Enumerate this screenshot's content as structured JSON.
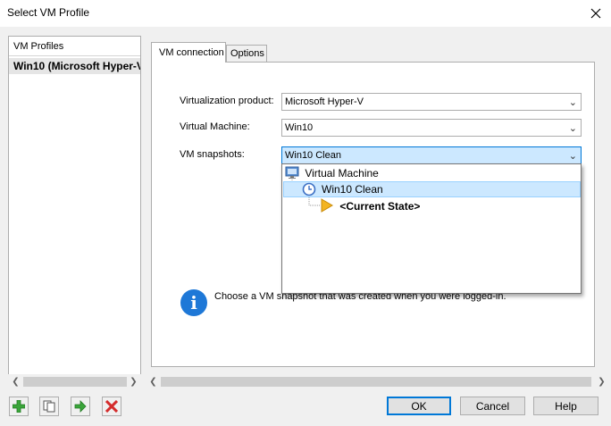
{
  "window": {
    "title": "Select VM Profile",
    "close_icon": "close-icon"
  },
  "profiles": {
    "header": "VM Profiles",
    "items": [
      {
        "label": "Win10 (Microsoft Hyper-V"
      }
    ]
  },
  "tabs": [
    {
      "label": "VM connection",
      "active": true
    },
    {
      "label": "Options",
      "active": false
    }
  ],
  "form": {
    "virtualization_label": "Virtualization product:",
    "virtualization_value": "Microsoft Hyper-V",
    "machine_label": "Virtual Machine:",
    "machine_value": "Win10",
    "snapshots_label": "VM snapshots:",
    "snapshots_value": "Win10 Clean"
  },
  "dropdown": {
    "items": [
      {
        "label": "Virtual Machine",
        "icon": "monitor-icon"
      },
      {
        "label": "Win10 Clean",
        "icon": "clock-icon",
        "selected": true
      },
      {
        "label": "<Current State>",
        "icon": "play-arrow-icon"
      }
    ]
  },
  "info": {
    "text": "Choose a VM snapshot that was created when you were logged-in."
  },
  "buttons": {
    "ok": "OK",
    "cancel": "Cancel",
    "help": "Help"
  },
  "colors": {
    "accent": "#0078d7",
    "selection": "#cce8ff",
    "add_green": "#3aa53a",
    "delete_red": "#d42b2b",
    "info_blue": "#1e78d7"
  }
}
